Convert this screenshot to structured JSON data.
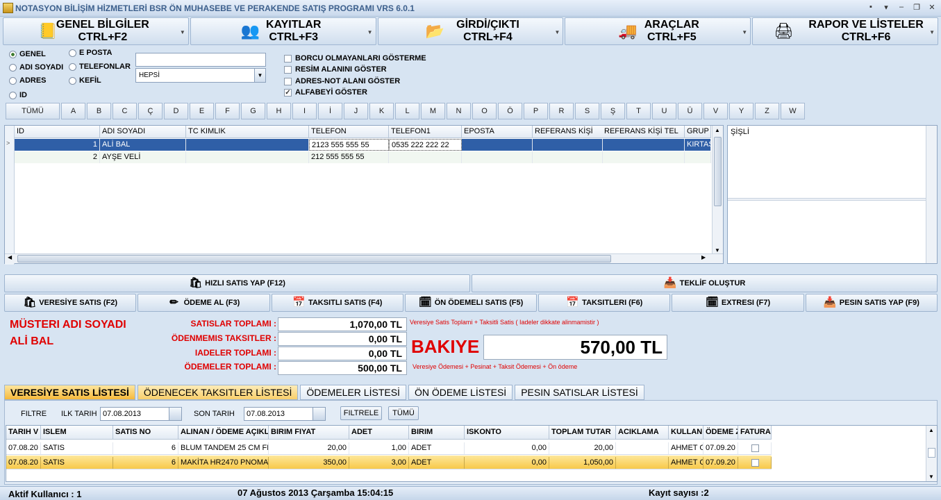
{
  "window": {
    "title": "NOTASYON BİLİŞİM HİZMETLERİ BSR ÖN MUHASEBE VE PERAKENDE SATIŞ PROGRAMI VRS 6.0.1"
  },
  "menu": [
    {
      "line1": "GENEL BİLGİLER",
      "line2": "CTRL+F2",
      "icon": "notebook-icon"
    },
    {
      "line1": "KAYITLAR",
      "line2": "CTRL+F3",
      "icon": "users-icon"
    },
    {
      "line1": "GİRDİ/ÇIKTI",
      "line2": "CTRL+F4",
      "icon": "folder-icon"
    },
    {
      "line1": "ARAÇLAR",
      "line2": "CTRL+F5",
      "icon": "truck-icon"
    },
    {
      "line1": "RAPOR VE LİSTELER",
      "line2": "CTRL+F6",
      "icon": "printer-icon"
    }
  ],
  "filters": {
    "radios": [
      "GENEL",
      "ADI SOYADI",
      "ADRES",
      "ID",
      "E POSTA",
      "TELEFONLAR",
      "KEFİL"
    ],
    "search_value": "",
    "combo_value": "HEPSİ",
    "checks": [
      {
        "label": "BORCU OLMAYANLARI GÖSTERME",
        "checked": false
      },
      {
        "label": "RESİM ALANINI GÖSTER",
        "checked": false
      },
      {
        "label": "ADRES-NOT ALANI GÖSTER",
        "checked": false
      },
      {
        "label": "ALFABEYİ GÖSTER",
        "checked": true
      }
    ]
  },
  "alphabet": [
    "TÜMÜ",
    "A",
    "B",
    "C",
    "Ç",
    "D",
    "E",
    "F",
    "G",
    "H",
    "I",
    "İ",
    "J",
    "K",
    "L",
    "M",
    "N",
    "O",
    "Ö",
    "P",
    "R",
    "S",
    "Ş",
    "T",
    "U",
    "Ü",
    "V",
    "Y",
    "Z",
    "W"
  ],
  "customers": {
    "columns": [
      "ID",
      "ADI SOYADI",
      "TC KIMLIK",
      "TELEFON",
      "TELEFON1",
      "EPOSTA",
      "REFERANS KİŞİ",
      "REFERANS KİŞİ TEL",
      "GRUP"
    ],
    "rows": [
      [
        "1",
        "ALİ BAL",
        "",
        "2123 555 555 55",
        "0535 222 222 22",
        "",
        "",
        "",
        "KIRTAS"
      ],
      [
        "2",
        "AYŞE VELİ",
        "",
        "212 555 555 55",
        "",
        "",
        "",
        "",
        ""
      ]
    ],
    "side_text": "ŞİŞLİ"
  },
  "actions": {
    "hizli": "HIZLI SATIS YAP  (F12)",
    "teklif": "TEKLİF OLUŞTUR",
    "row": [
      "VERESİYE SATIS  (F2)",
      "ÖDEME AL (F3)",
      "TAKSITLI SATIS  (F4)",
      "ÖN ÖDEMELI SATIS  (F5)",
      "TAKSITLERI  (F6)",
      "EXTRESI  (F7)",
      "PESIN SATIS YAP  (F9)"
    ]
  },
  "customer_summary": {
    "label": "MÜSTERI ADI SOYADI",
    "name": "ALİ BAL",
    "totals": [
      {
        "label": "SATISLAR TOPLAMI :",
        "value": "1,070,00 TL"
      },
      {
        "label": "ÖDENMEMIS TAKSITLER :",
        "value": "0,00 TL"
      },
      {
        "label": "IADELER TOPLAMI :",
        "value": "0,00 TL"
      },
      {
        "label": "ÖDEMELER TOPLAMI :",
        "value": "500,00 TL"
      }
    ],
    "note1": "Veresiye Satis Toplami + Taksitli Satis ( Iadeler dikkate alinmamistir )",
    "bakiye_label": "BAKIYE",
    "bakiye_value": "570,00 TL",
    "note2": "Veresiye Ödemesi + Pesinat + Taksit Ödemesi + Ön ödeme"
  },
  "tabs": [
    "VERESİYE SATIS LİSTESİ",
    "ÖDENECEK TAKSITLER LİSTESİ",
    "ÖDEMELER LİSTESİ",
    "ÖN ÖDEME LİSTESİ",
    "PESIN SATISLAR LİSTESİ"
  ],
  "list_filter": {
    "filtre": "FILTRE",
    "ilk_label": "ILK TARIH",
    "ilk_value": "07.08.2013",
    "son_label": "SON TARIH",
    "son_value": "07.08.2013",
    "filter_btn": "FILTRELE",
    "all_btn": "TÜMÜ"
  },
  "sales": {
    "columns": [
      "TARIH V",
      "ISLEM",
      "SATIS NO",
      "ALINAN / ÖDEME AÇIKL",
      "BIRIM FIYAT",
      "ADET",
      "BIRIM",
      "ISKONTO",
      "TOPLAM TUTAR",
      "ACIKLAMA",
      "KULLAN",
      "ÖDEME Z",
      "FATURA"
    ],
    "rows": [
      [
        "07.08.20",
        "SATIS",
        "6",
        "BLUM TANDEM 25 CM FR",
        "20,00",
        "1,00",
        "ADET",
        "0,00",
        "20,00",
        "",
        "AHMET C",
        "07.09.20",
        ""
      ],
      [
        "07.08.20",
        "SATIS",
        "6",
        "MAKİTA HR2470 PNOMAT",
        "350,00",
        "3,00",
        "ADET",
        "0,00",
        "1,050,00",
        "",
        "AHMET C",
        "07.09.20",
        ""
      ]
    ]
  },
  "status": {
    "user": "Aktif Kullanıcı :  1",
    "datetime": "07 Ağustos 2013 Çarşamba 15:04:15",
    "count": "Kayıt sayısı :2"
  }
}
